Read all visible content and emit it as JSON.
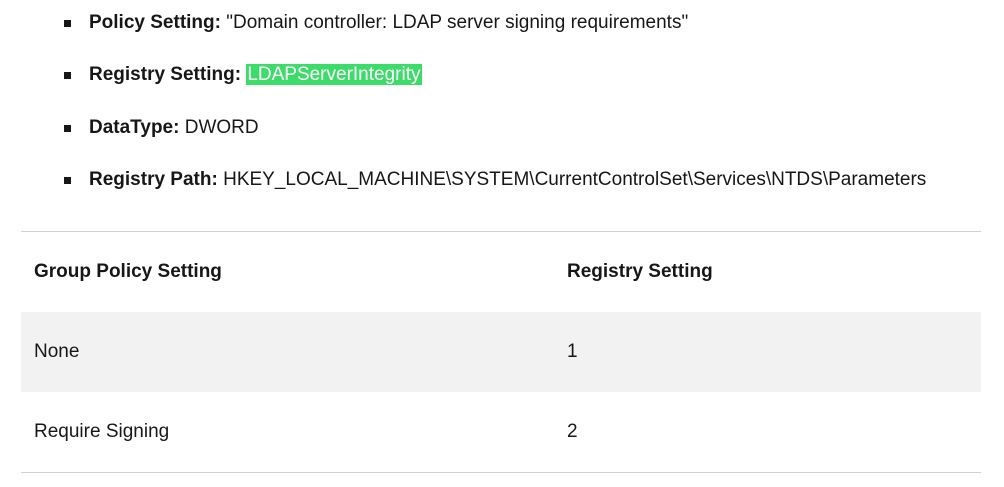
{
  "details": [
    {
      "label": "Policy Setting:",
      "value": "\"Domain controller: LDAP server signing requirements\""
    },
    {
      "label": "Registry Setting:",
      "value": "LDAPServerIntegrity"
    },
    {
      "label": "DataType:",
      "value": "DWORD"
    },
    {
      "label": "Registry Path:",
      "value": "HKEY_LOCAL_MACHINE\\SYSTEM\\CurrentControlSet\\Services\\NTDS\\Parameters"
    }
  ],
  "highlight_color": "#3ddc6a",
  "table": {
    "headers": [
      "Group Policy Setting",
      "Registry Setting"
    ],
    "rows": [
      [
        "None",
        "1"
      ],
      [
        "Require Signing",
        "2"
      ]
    ]
  }
}
